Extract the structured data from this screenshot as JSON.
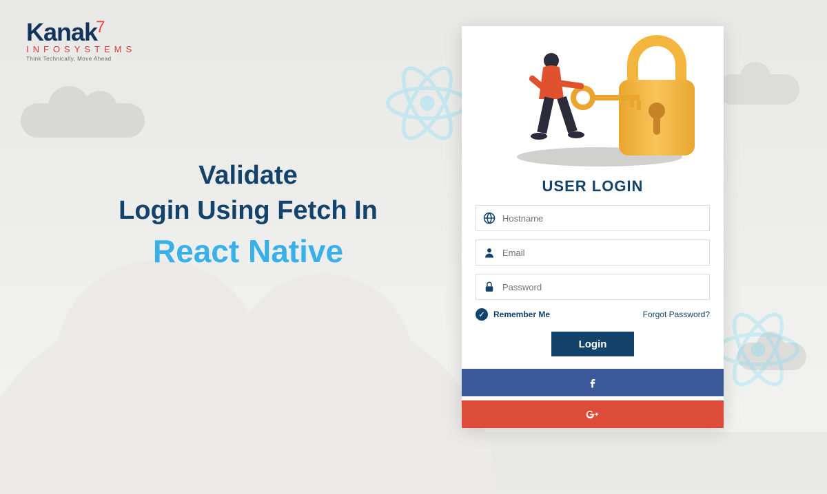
{
  "brand": {
    "name": "Kanak",
    "sub": "INFOSYSTEMS",
    "tagline": "Think Technically, Move Ahead"
  },
  "headline": {
    "line1": "Validate",
    "line2": "Login Using Fetch In",
    "accent": "React Native"
  },
  "card": {
    "title": "USER LOGIN",
    "fields": {
      "hostname_placeholder": "Hostname",
      "email_placeholder": "Email",
      "password_placeholder": "Password"
    },
    "remember_label": "Remember Me",
    "forgot_label": "Forgot Password?",
    "login_label": "Login"
  },
  "colors": {
    "primary": "#13436b",
    "accent": "#39b0e8",
    "facebook": "#3b5998",
    "google": "#dd4b39"
  }
}
